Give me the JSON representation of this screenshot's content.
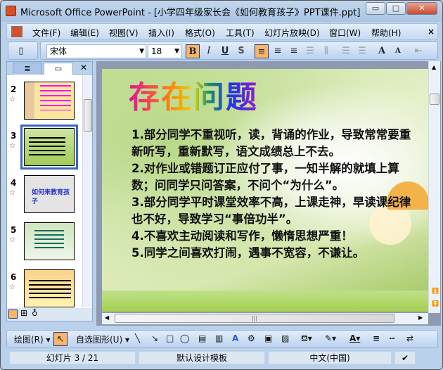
{
  "window": {
    "title": "Microsoft Office PowerPoint - [小学四年级家长会《如何教育孩子》PPT课件.ppt]",
    "minimize": "▭",
    "maximize": "□",
    "close": "✕"
  },
  "menu": [
    "文件(F)",
    "编辑(E)",
    "视图(V)",
    "插入(I)",
    "格式(O)",
    "工具(T)",
    "幻灯片放映(D)",
    "窗口(W)",
    "帮助(H)"
  ],
  "menu_close": "×",
  "toolbar": {
    "font": "宋体",
    "size": "18",
    "bold": "B",
    "italic": "I",
    "underline": "U",
    "shadow": "S",
    "grow": "A",
    "shrink": "A"
  },
  "panel": {
    "tab_outline": "≣",
    "tab_slides": "▭",
    "close": "✕",
    "slides": [
      {
        "num": "2",
        "star": "☆"
      },
      {
        "num": "3",
        "star": "☆"
      },
      {
        "num": "4",
        "star": "☆",
        "thumb_text": "如何来教育孩子"
      },
      {
        "num": "5",
        "star": "☆"
      },
      {
        "num": "6",
        "star": "☆"
      }
    ]
  },
  "slide": {
    "title": "存在问题",
    "body": [
      "1.部分同学不重视听，读，背诵的作业，导致常常要重新听写，重新默写，语文成绩总上不去。",
      "2.对作业或错题订正应付了事，一知半解的就填上算数；问同学只问答案，不问个“为什么”。",
      "3.部分同学平时课堂效率不高，上课走神，早读课纪律也不好，导致学习“事倍功半”。",
      "4.不喜欢主动阅读和写作，懒惰思想严重！",
      "5.同学之间喜欢打闹，遇事不宽容，不谦让。"
    ]
  },
  "drawing": {
    "draw": "绘图(R)",
    "autoshapes": "自选图形(U)"
  },
  "status": {
    "slide": "幻灯片 3 / 21",
    "template": "默认设计模板",
    "language": "中文(中国)"
  },
  "colors": {
    "selected": "#fcb466",
    "thumb_border": "#3a66c4"
  }
}
